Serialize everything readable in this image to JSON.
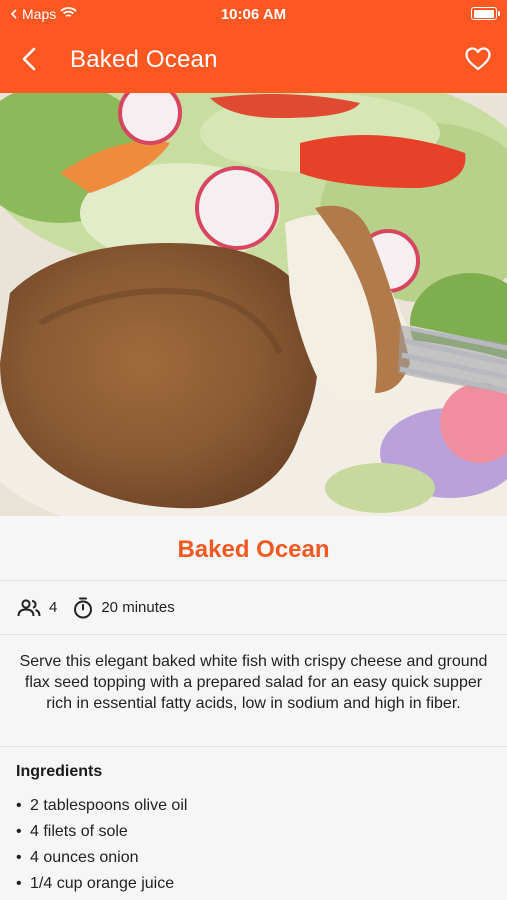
{
  "status_bar": {
    "carrier": "Maps",
    "time": "10:06 AM"
  },
  "app_bar": {
    "title": "Baked Ocean"
  },
  "recipe": {
    "title": "Baked Ocean",
    "servings": "4",
    "time": "20 minutes",
    "description": "Serve this elegant baked white fish with crispy cheese and ground flax seed topping with a prepared salad for an easy quick supper rich in essential fatty acids, low in sodium and high in fiber."
  },
  "ingredients": {
    "heading": "Ingredients",
    "items": [
      "2 tablespoons olive oil",
      "4 filets of sole",
      "4 ounces onion",
      "1/4 cup orange juice"
    ]
  },
  "colors": {
    "accent": "#fe5722",
    "title": "#f05a22"
  }
}
